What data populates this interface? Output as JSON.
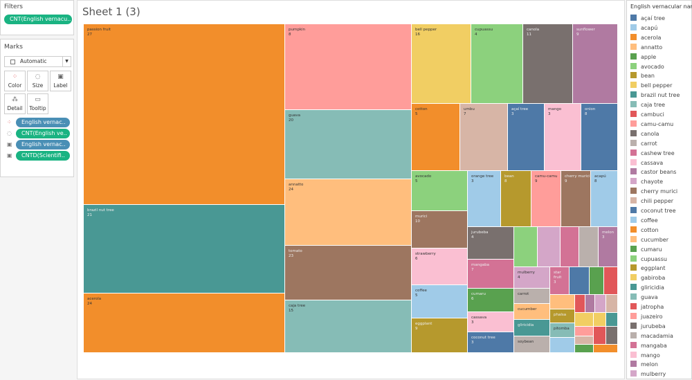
{
  "filters": {
    "title": "Filters",
    "pills": [
      "CNT(English vernacu.."
    ]
  },
  "marks": {
    "title": "Marks",
    "type": "Automatic",
    "buttons": [
      {
        "label": "Color",
        "icon": "color-dots-icon"
      },
      {
        "label": "Size",
        "icon": "size-icon"
      },
      {
        "label": "Label",
        "icon": "label-icon"
      },
      {
        "label": "Detail",
        "icon": "detail-icon"
      },
      {
        "label": "Tooltip",
        "icon": "tooltip-icon"
      }
    ],
    "fields": [
      {
        "label": "English vernac..",
        "kind": "color",
        "pill": "blue"
      },
      {
        "label": "CNT(English ve..",
        "kind": "size",
        "pill": "green"
      },
      {
        "label": "English vernac..",
        "kind": "label",
        "pill": "blue"
      },
      {
        "label": "CNTD(Scientifi..",
        "kind": "label",
        "pill": "green"
      }
    ]
  },
  "sheet": {
    "title": "Sheet 1 (3)"
  },
  "chart_data": {
    "type": "treemap",
    "size_field": "CNT(English vernacular name)",
    "label_field": "CNTD(Scientific name)",
    "items": [
      {
        "name": "passion fruit",
        "value": "27",
        "color": "#f28e2b"
      },
      {
        "name": "brazil nut tree",
        "value": "21",
        "color": "#499894"
      },
      {
        "name": "acerola",
        "value": "24",
        "color": "#f28e2b"
      },
      {
        "name": "pumpkin",
        "value": "8",
        "color": "#ff9d9a"
      },
      {
        "name": "guava",
        "value": "20",
        "color": "#86bcb6"
      },
      {
        "name": "annatto",
        "value": "24",
        "color": "#ffbe7d"
      },
      {
        "name": "tomato",
        "value": "23",
        "color": "#9d7660"
      },
      {
        "name": "caja tree",
        "value": "15",
        "color": "#86bcb6"
      },
      {
        "name": "bell pepper",
        "value": "16",
        "color": "#f1ce63"
      },
      {
        "name": "cupuassu",
        "value": "4",
        "color": "#8cd17d"
      },
      {
        "name": "canola",
        "value": "11",
        "color": "#79706e"
      },
      {
        "name": "sunflower",
        "value": "9",
        "color": "#b07aa1"
      },
      {
        "name": "cotton",
        "value": "5",
        "color": "#f28e2b"
      },
      {
        "name": "umbu",
        "value": "7",
        "color": "#d7b5a6"
      },
      {
        "name": "açaí tree",
        "value": "3",
        "color": "#4e79a7"
      },
      {
        "name": "mango",
        "value": "3",
        "color": "#fabfd2"
      },
      {
        "name": "onion",
        "value": "8",
        "color": "#4e79a7"
      },
      {
        "name": "avocado",
        "value": "5",
        "color": "#8cd17d"
      },
      {
        "name": "murici",
        "value": "10",
        "color": "#9d7660"
      },
      {
        "name": "strawberry",
        "value": "6",
        "color": "#fabfd2"
      },
      {
        "name": "coffee",
        "value": "5",
        "color": "#a0cbe8"
      },
      {
        "name": "eggplant",
        "value": "9",
        "color": "#b6992d"
      },
      {
        "name": "orange tree",
        "value": "3",
        "color": "#a0cbe8"
      },
      {
        "name": "bean",
        "value": "8",
        "color": "#b6992d"
      },
      {
        "name": "camu-camu",
        "value": "9",
        "color": "#ff9d9a"
      },
      {
        "name": "cherry murici",
        "value": "9",
        "color": "#9d7660"
      },
      {
        "name": "acapú",
        "value": "8",
        "color": "#a0cbe8"
      },
      {
        "name": "jurubeba",
        "value": "4",
        "color": "#79706e"
      },
      {
        "name": "mangaba",
        "value": "7",
        "color": "#d37295"
      },
      {
        "name": "cumaru",
        "value": "6",
        "color": "#59a14f"
      },
      {
        "name": "cassava",
        "value": "3",
        "color": "#fabfd2"
      },
      {
        "name": "coconut tree",
        "value": "3",
        "color": "#4e79a7"
      },
      {
        "name": "",
        "value": "",
        "color": "#8cd17d"
      },
      {
        "name": "",
        "value": "",
        "color": "#d4a6c8"
      },
      {
        "name": "",
        "value": "",
        "color": "#d37295"
      },
      {
        "name": "",
        "value": "",
        "color": "#bab0ac"
      },
      {
        "name": "melon",
        "value": "3",
        "color": "#b07aa1"
      },
      {
        "name": "mulberry",
        "value": "4",
        "color": "#d4a6c8"
      },
      {
        "name": "carrot",
        "value": "",
        "color": "#bab0ac"
      },
      {
        "name": "cucumber",
        "value": "",
        "color": "#ffbe7d"
      },
      {
        "name": "gliricidia",
        "value": "",
        "color": "#499894"
      },
      {
        "name": "soybean",
        "value": "",
        "color": "#bab0ac"
      },
      {
        "name": "star fruit",
        "value": "3",
        "color": "#d37295"
      },
      {
        "name": "",
        "value": "",
        "color": "#4e79a7"
      },
      {
        "name": "",
        "value": "",
        "color": "#59a14f"
      },
      {
        "name": "",
        "value": "",
        "color": "#e15759"
      },
      {
        "name": "",
        "value": "",
        "color": "#ffbe7d"
      },
      {
        "name": "phalsa",
        "value": "",
        "color": "#b6992d"
      },
      {
        "name": "pitomba",
        "value": "",
        "color": "#86bcb6"
      },
      {
        "name": "",
        "value": "",
        "color": "#a0cbe8"
      },
      {
        "name": "",
        "value": "",
        "color": "#e15759"
      },
      {
        "name": "",
        "value": "",
        "color": "#b07aa1"
      },
      {
        "name": "",
        "value": "",
        "color": "#d4a6c8"
      },
      {
        "name": "",
        "value": "",
        "color": "#d7b5a6"
      },
      {
        "name": "",
        "value": "",
        "color": "#f1ce63"
      },
      {
        "name": "",
        "value": "",
        "color": "#f1ce63"
      },
      {
        "name": "",
        "value": "",
        "color": "#499894"
      },
      {
        "name": "",
        "value": "",
        "color": "#ff9d9a"
      },
      {
        "name": "",
        "value": "",
        "color": "#d7b5a6"
      },
      {
        "name": "",
        "value": "",
        "color": "#e15759"
      },
      {
        "name": "",
        "value": "",
        "color": "#79706e"
      },
      {
        "name": "",
        "value": "",
        "color": "#59a14f"
      },
      {
        "name": "",
        "value": "",
        "color": "#f28e2b"
      }
    ]
  },
  "legend": {
    "title": "English vernacular name",
    "items": [
      {
        "label": "açaí tree",
        "color": "#4e79a7"
      },
      {
        "label": "acapú",
        "color": "#a0cbe8"
      },
      {
        "label": "acerola",
        "color": "#f28e2b"
      },
      {
        "label": "annatto",
        "color": "#ffbe7d"
      },
      {
        "label": "apple",
        "color": "#59a14f"
      },
      {
        "label": "avocado",
        "color": "#8cd17d"
      },
      {
        "label": "bean",
        "color": "#b6992d"
      },
      {
        "label": "bell pepper",
        "color": "#f1ce63"
      },
      {
        "label": "brazil nut tree",
        "color": "#499894"
      },
      {
        "label": "caja tree",
        "color": "#86bcb6"
      },
      {
        "label": "cambuci",
        "color": "#e15759"
      },
      {
        "label": "camu-camu",
        "color": "#ff9d9a"
      },
      {
        "label": "canola",
        "color": "#79706e"
      },
      {
        "label": "carrot",
        "color": "#bab0ac"
      },
      {
        "label": "cashew tree",
        "color": "#d37295"
      },
      {
        "label": "cassava",
        "color": "#fabfd2"
      },
      {
        "label": "castor beans",
        "color": "#b07aa1"
      },
      {
        "label": "chayote",
        "color": "#d4a6c8"
      },
      {
        "label": "cherry murici",
        "color": "#9d7660"
      },
      {
        "label": "chili pepper",
        "color": "#d7b5a6"
      },
      {
        "label": "coconut tree",
        "color": "#4e79a7"
      },
      {
        "label": "coffee",
        "color": "#a0cbe8"
      },
      {
        "label": "cotton",
        "color": "#f28e2b"
      },
      {
        "label": "cucumber",
        "color": "#ffbe7d"
      },
      {
        "label": "cumaru",
        "color": "#59a14f"
      },
      {
        "label": "cupuassu",
        "color": "#8cd17d"
      },
      {
        "label": "eggplant",
        "color": "#b6992d"
      },
      {
        "label": "gabiroba",
        "color": "#f1ce63"
      },
      {
        "label": "gliricidia",
        "color": "#499894"
      },
      {
        "label": "guava",
        "color": "#86bcb6"
      },
      {
        "label": "jatropha",
        "color": "#e15759"
      },
      {
        "label": "juazeiro",
        "color": "#ff9d9a"
      },
      {
        "label": "jurubeba",
        "color": "#79706e"
      },
      {
        "label": "macadamia",
        "color": "#bab0ac"
      },
      {
        "label": "mangaba",
        "color": "#d37295"
      },
      {
        "label": "mango",
        "color": "#fabfd2"
      },
      {
        "label": "melon",
        "color": "#b07aa1"
      },
      {
        "label": "mulberry",
        "color": "#d4a6c8"
      }
    ]
  }
}
